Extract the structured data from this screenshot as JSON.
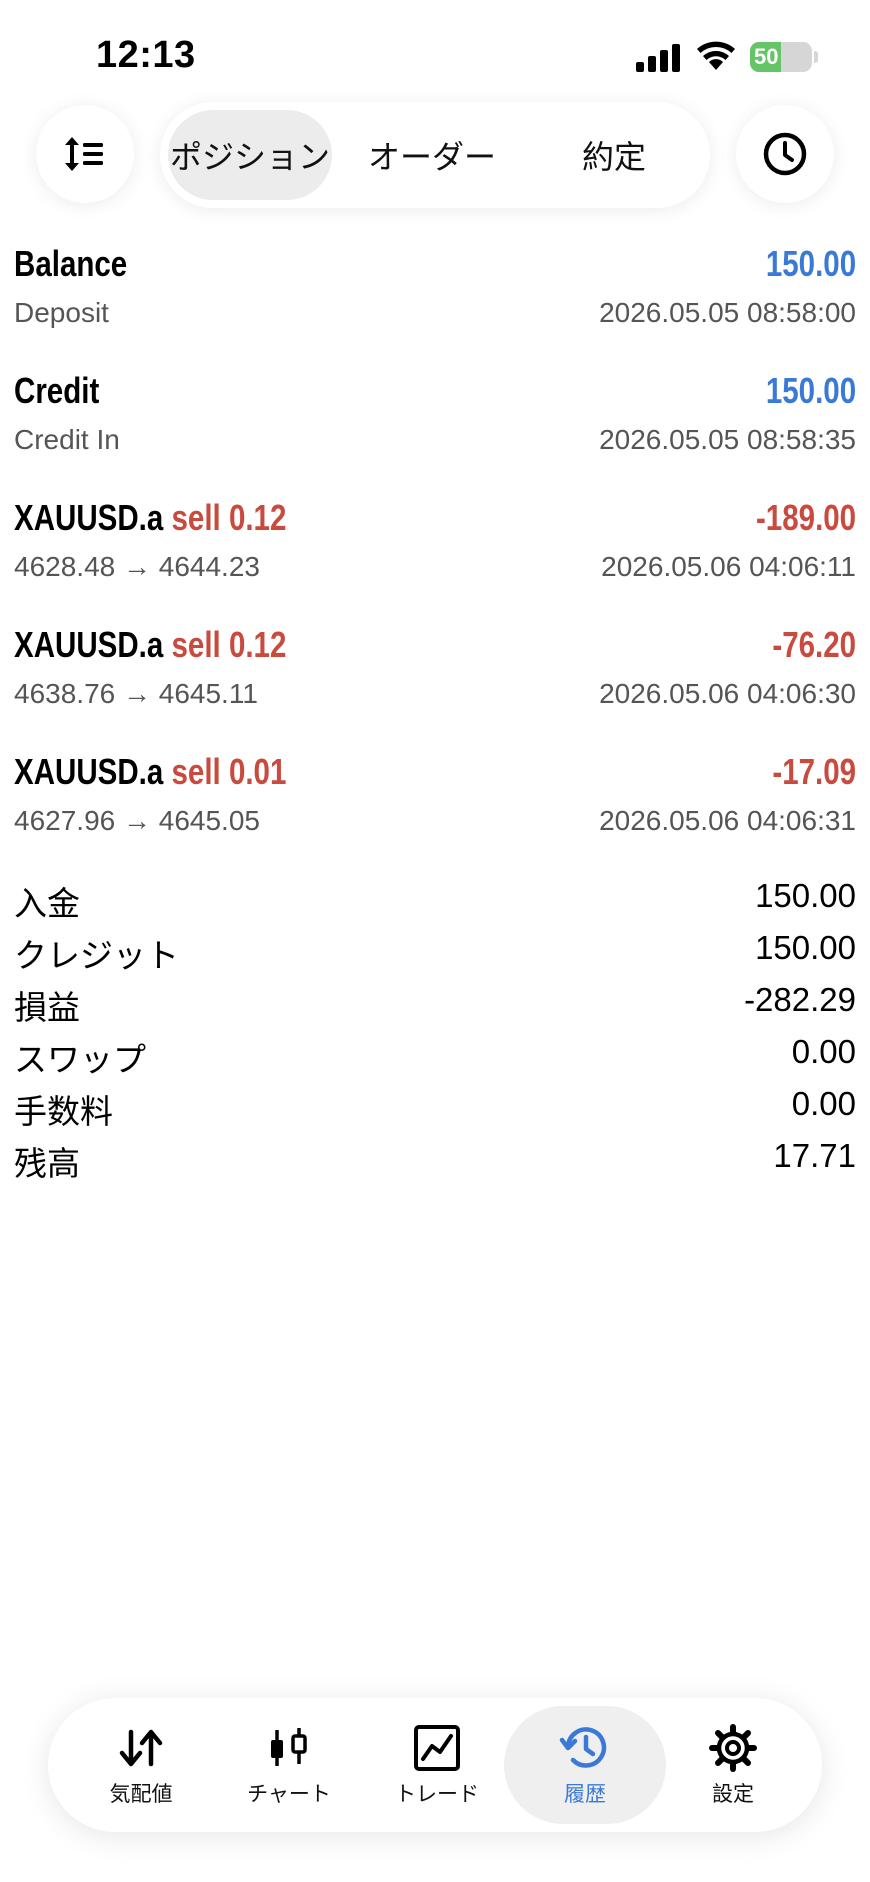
{
  "status": {
    "time": "12:13",
    "battery_percent": 50,
    "battery_label": "50"
  },
  "tabs": [
    {
      "label": "ポジション",
      "active": true
    },
    {
      "label": "オーダー",
      "active": false
    },
    {
      "label": "約定",
      "active": false
    }
  ],
  "icons": {
    "sort": "sort-icon",
    "clock": "clock-icon"
  },
  "deals": [
    {
      "title": "Balance",
      "amount": "150.00",
      "subtitle": "Deposit",
      "time": "2026.05.05 08:58:00"
    },
    {
      "title": "Credit",
      "amount": "150.00",
      "subtitle": "Credit In",
      "time": "2026.05.05 08:58:35"
    },
    {
      "symbol": "XAUUSD.a",
      "side": "sell",
      "volume": "0.12",
      "amount": "-189.00",
      "prices": "4628.48 → 4644.23",
      "time": "2026.05.06 04:06:11"
    },
    {
      "symbol": "XAUUSD.a",
      "side": "sell",
      "volume": "0.12",
      "amount": "-76.20",
      "prices": "4638.76 → 4645.11",
      "time": "2026.05.06 04:06:30"
    },
    {
      "symbol": "XAUUSD.a",
      "side": "sell",
      "volume": "0.01",
      "amount": "-17.09",
      "prices": "4627.96 → 4645.05",
      "time": "2026.05.06 04:06:31"
    }
  ],
  "summary": [
    {
      "label": "入金",
      "value": "150.00"
    },
    {
      "label": "クレジット",
      "value": "150.00"
    },
    {
      "label": "損益",
      "value": "-282.29"
    },
    {
      "label": "スワップ",
      "value": "0.00"
    },
    {
      "label": "手数料",
      "value": "0.00"
    },
    {
      "label": "残高",
      "value": "17.71"
    }
  ],
  "nav": [
    {
      "label": "気配値",
      "icon": "quotes-arrows-icon",
      "active": false
    },
    {
      "label": "チャート",
      "icon": "chart-candles-icon",
      "active": false
    },
    {
      "label": "トレード",
      "icon": "trade-chart-icon",
      "active": false
    },
    {
      "label": "履歴",
      "icon": "history-icon",
      "active": true
    },
    {
      "label": "設定",
      "icon": "settings-gear-icon",
      "active": false
    }
  ],
  "colors": {
    "accent_blue": "#3a7ad6",
    "loss_red": "#c94a3f",
    "battery_green": "#65c466"
  }
}
